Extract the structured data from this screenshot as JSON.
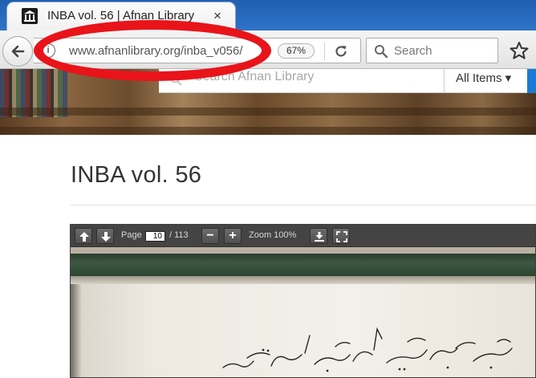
{
  "browser": {
    "tab_title": "INBA vol. 56 | Afnan Library",
    "tab_close": "×",
    "url": "www.afnanlibrary.org/inba_v056/",
    "zoom_level": "67%",
    "search_placeholder": "Search",
    "info_glyph": "i"
  },
  "site": {
    "search_placeholder": "Search Afnan Library",
    "all_items_label": "All Items ▾",
    "accent_color": "#1a7bd6"
  },
  "page": {
    "title": "INBA vol. 56"
  },
  "viewer": {
    "page_label": "Page",
    "current_page": "10",
    "total_pages": "/ 113",
    "minus_label": "−",
    "plus_label": "+",
    "zoom_label": "Zoom 100%"
  },
  "annotation": {
    "highlight_color": "#e8141a"
  }
}
